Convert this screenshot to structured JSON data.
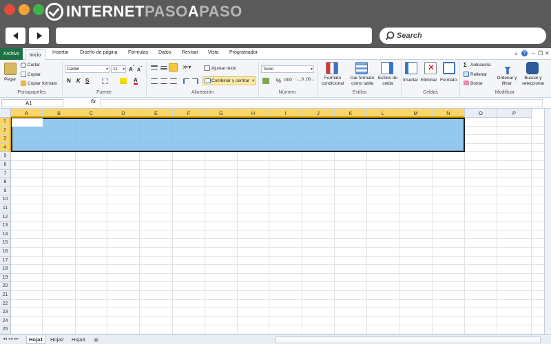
{
  "browser": {
    "logo": "INTERNETPASOAPASO",
    "logo_part1": "INTERNET",
    "logo_part2": "PASO",
    "logo_part3": "A",
    "logo_part4": "PASO",
    "search_label": "Search",
    "dot_colors": [
      "#e24b3b",
      "#f2a33a",
      "#3db54a"
    ]
  },
  "tabs": [
    "Archivo",
    "Inicio",
    "Insertar",
    "Diseño de página",
    "Fórmulas",
    "Datos",
    "Revisar",
    "Vista",
    "Programador"
  ],
  "ribbon": {
    "clipboard": {
      "paste": "Pegar",
      "cut": "Cortar",
      "copy": "Copiar",
      "copy_format": "Copiar formato",
      "label": "Portapapeles"
    },
    "font": {
      "name": "Calibri",
      "size": "11",
      "bold": "N",
      "italic": "K",
      "underline": "S",
      "label": "Fuente"
    },
    "alignment": {
      "wrap": "Ajustar texto",
      "merge": "Combinar y centrar",
      "label": "Alineación"
    },
    "number": {
      "format": "Texto",
      "percent": "%",
      "thousands": "000",
      "label": "Número"
    },
    "styles": {
      "conditional": "Formato condicional",
      "as_table": "Dar formato como tabla",
      "cell_styles": "Estilos de celda",
      "label": "Estilos"
    },
    "cells": {
      "insert": "Insertar",
      "delete": "Eliminar",
      "format": "Formato",
      "label": "Celdas"
    },
    "editing": {
      "autosum": "Autosuma",
      "fill": "Rellenar",
      "clear": "Borrar",
      "sort": "Ordenar y filtrar",
      "find": "Buscar y seleccionar",
      "label": "Modificar"
    }
  },
  "formula_bar": {
    "name_box": "A1",
    "fx": "fx",
    "value": ""
  },
  "columns": [
    "A",
    "B",
    "C",
    "D",
    "E",
    "F",
    "G",
    "H",
    "I",
    "J",
    "K",
    "L",
    "M",
    "N",
    "O",
    "P"
  ],
  "rows": [
    "1",
    "2",
    "3",
    "4",
    "5",
    "6",
    "7",
    "8",
    "9",
    "10",
    "11",
    "12",
    "13",
    "14",
    "15",
    "16",
    "17",
    "18",
    "19",
    "20",
    "21",
    "22",
    "23",
    "24",
    "25"
  ],
  "sheets": [
    "Hoja1",
    "Hoja2",
    "Hoja3"
  ],
  "selection": {
    "range": "A1:N4",
    "color": "#82beeb"
  }
}
